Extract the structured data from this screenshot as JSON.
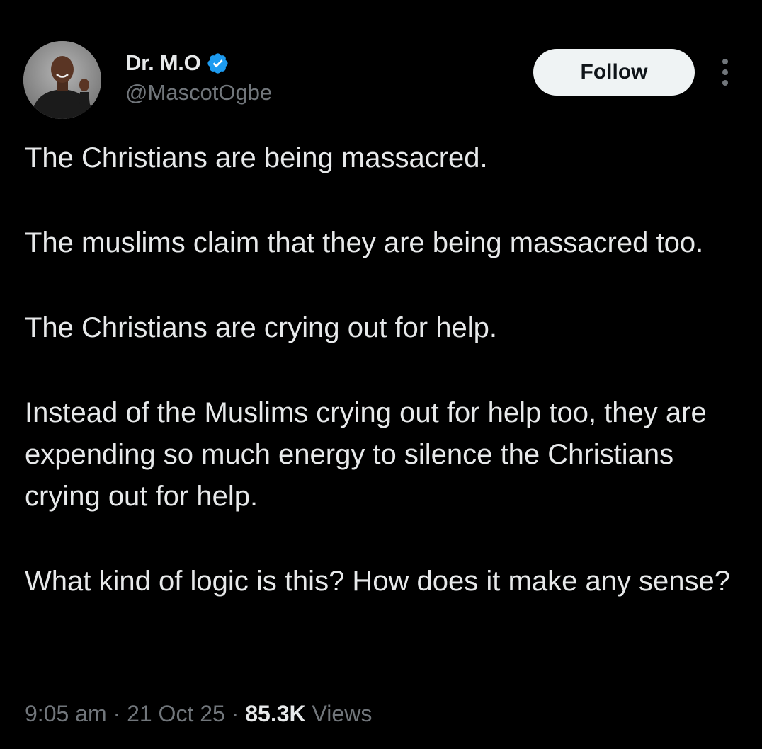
{
  "tweet": {
    "author": {
      "display_name": "Dr. M.O",
      "handle": "@MascotOgbe",
      "verified": true
    },
    "follow_label": "Follow",
    "paragraphs": [
      "The Christians are being massacred.",
      "The muslims claim that they are being massacred too.",
      "The Christians are crying out for help.",
      "Instead of the Muslims crying out for help too, they are expending so much energy to silence the Christians crying out for help.",
      "What kind of logic is this? How does it make any sense?"
    ],
    "time": "9:05 am",
    "separator": "·",
    "date": "21 Oct 25",
    "views_count": "85.3K",
    "views_label": "Views"
  },
  "icons": {
    "verified": "verified-badge-icon",
    "more": "more-options-icon"
  },
  "colors": {
    "background": "#000000",
    "text_primary": "#e7e9ea",
    "text_secondary": "#71767b",
    "verified_blue": "#1d9bf0",
    "follow_button_bg": "#eff3f4",
    "follow_button_text": "#0f1419",
    "divider": "#2f3336"
  }
}
